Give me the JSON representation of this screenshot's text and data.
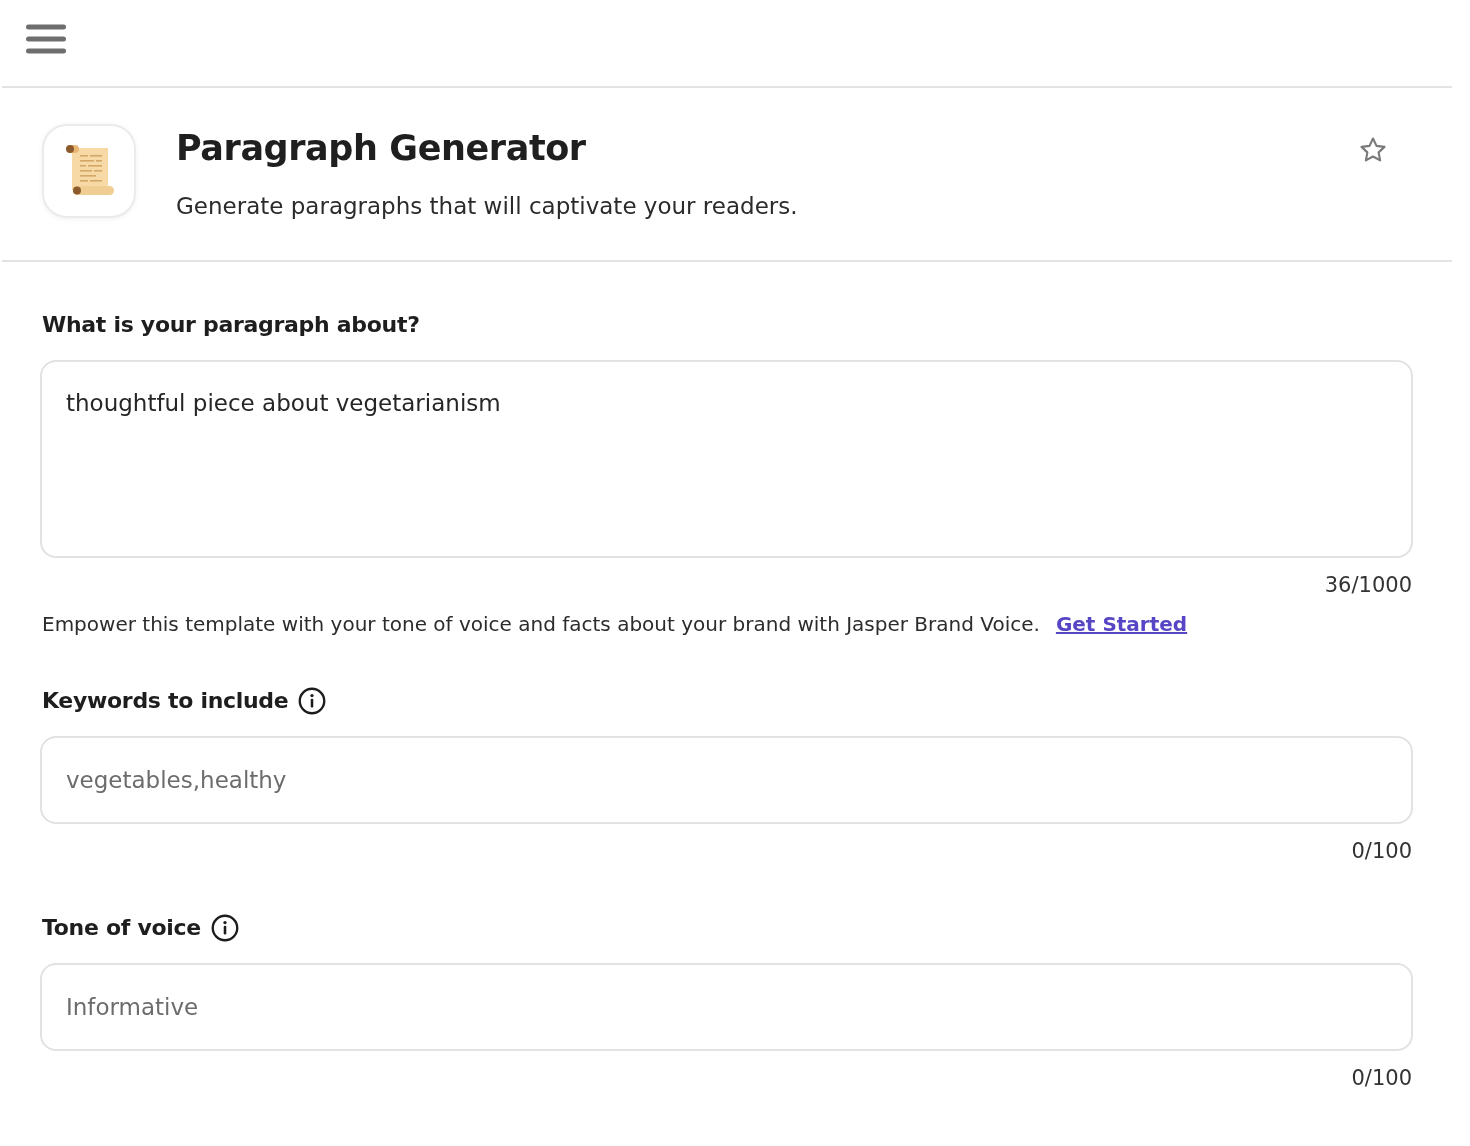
{
  "header": {
    "title": "Paragraph Generator",
    "subtitle": "Generate paragraphs that will captivate your readers.",
    "favorite": false
  },
  "fields": [
    {
      "kind": "textarea",
      "label": "What is your paragraph about?",
      "info": false,
      "value": "thoughtful piece about vegetarianism",
      "counter": "36/1000",
      "note": {
        "text": "Empower this template with your tone of voice and facts about your brand with Jasper Brand Voice.",
        "link": "Get Started"
      }
    },
    {
      "kind": "input",
      "label": "Keywords to include",
      "info": true,
      "placeholder": "vegetables,healthy",
      "counter": "0/100"
    },
    {
      "kind": "input",
      "label": "Tone of voice",
      "info": true,
      "placeholder": "Informative",
      "counter": "0/100"
    }
  ]
}
